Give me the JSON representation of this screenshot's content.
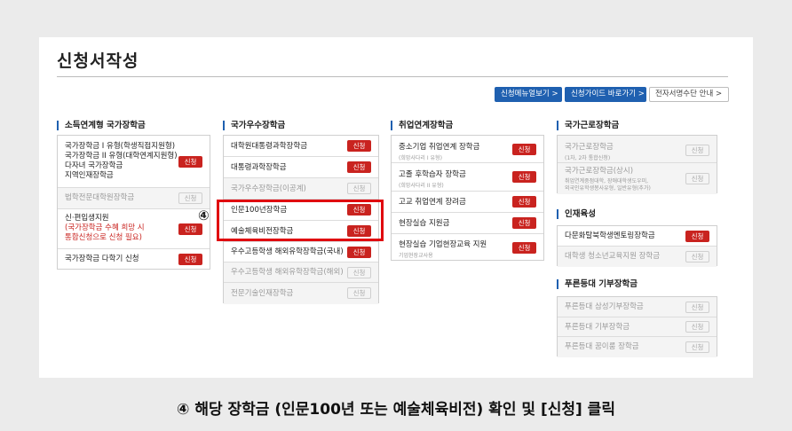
{
  "page": {
    "title": "신청서작성"
  },
  "top_links": [
    {
      "label": "신청메뉴얼보기 >"
    },
    {
      "label": "신청가이드 바로가기 >"
    },
    {
      "label": "전자서명수단 안내 >"
    }
  ],
  "columns": [
    {
      "title": "소득연계형 국가장학금",
      "items": [
        {
          "lines": [
            "국가장학금 I 유형(학생직접지원형)",
            "국가장학금 II 유형(대학연계지원형)",
            "다자녀 국가장학금",
            "지역인재장학금"
          ],
          "button": "신청",
          "enabled": true
        },
        {
          "lines": [
            "법학전문대학원장학금"
          ],
          "button": "신청",
          "enabled": false
        },
        {
          "lines": [
            "신·편입생지원",
            "(국가장학금 수혜 희망 시",
            "통합신청으로 신청 필요)"
          ],
          "button": "신청",
          "enabled": true
        },
        {
          "lines": [
            "국가장학금 다학기 신청"
          ],
          "button": "신청",
          "enabled": true
        }
      ]
    },
    {
      "title": "국가우수장학금",
      "items": [
        {
          "lines": [
            "대학원대통령과학장학금"
          ],
          "button": "신청",
          "enabled": true
        },
        {
          "lines": [
            "대통령과학장학금"
          ],
          "button": "신청",
          "enabled": true
        },
        {
          "lines": [
            "국가우수장학금(이공계)"
          ],
          "button": "신청",
          "enabled": false
        },
        {
          "lines": [
            "인문100년장학금"
          ],
          "button": "신청",
          "enabled": true
        },
        {
          "lines": [
            "예술체육비전장학금"
          ],
          "button": "신청",
          "enabled": true
        },
        {
          "lines": [
            "우수고등학생 해외유학장학금(국내)"
          ],
          "button": "신청",
          "enabled": true
        },
        {
          "lines": [
            "우수고등학생 해외유학장학금(해외)"
          ],
          "button": "신청",
          "enabled": false
        },
        {
          "lines": [
            "전문기술인재장학금"
          ],
          "button": "신청",
          "enabled": false
        }
      ]
    },
    {
      "title": "취업연계장학금",
      "items": [
        {
          "lines": [
            "중소기업 취업연계 장학금"
          ],
          "sub": "(희망사다리 I 유형)",
          "button": "신청",
          "enabled": true
        },
        {
          "lines": [
            "고졸 후학습자 장학금"
          ],
          "sub": "(희망사다리 II 유형)",
          "button": "신청",
          "enabled": true
        },
        {
          "lines": [
            "고교 취업연계 장려금"
          ],
          "button": "신청",
          "enabled": true
        },
        {
          "lines": [
            "현장실습 지원금"
          ],
          "button": "신청",
          "enabled": true
        },
        {
          "lines": [
            "현장실습 기업현장교육 지원"
          ],
          "sub": "기업현장교사용",
          "button": "신청",
          "enabled": true
        }
      ]
    },
    {
      "title": "국가근로장학금",
      "items": [
        {
          "lines": [
            "국가근로장학금"
          ],
          "sub": "(1차, 2차 통합신청)",
          "button": "신청",
          "enabled": false
        },
        {
          "lines": [
            "국가근로장학금(상시)"
          ],
          "sub": "취업연계중점대학, 장애대학생도우미,",
          "sub2": "외국인유학생봉사유형, 일반유형(추가)",
          "button": "신청",
          "enabled": false
        }
      ],
      "sections": [
        {
          "title": "인재육성",
          "items": [
            {
              "lines": [
                "다문화탈북학생멘토링장학금"
              ],
              "button": "신청",
              "enabled": true
            },
            {
              "lines": [
                "대학생 청소년교육지원 장학금"
              ],
              "button": "신청",
              "enabled": false
            }
          ]
        },
        {
          "title": "푸른등대 기부장학금",
          "items": [
            {
              "lines": [
                "푸른등대 삼성기부장학금"
              ],
              "button": "신청",
              "enabled": false
            },
            {
              "lines": [
                "푸른등대 기부장학금"
              ],
              "button": "신청",
              "enabled": false
            },
            {
              "lines": [
                "푸른등대 꿈이룸 장학금"
              ],
              "button": "신청",
              "enabled": false
            }
          ]
        }
      ]
    }
  ],
  "annotation": {
    "badge": "④"
  },
  "caption": "④ 해당 장학금 (인문100년 또는 예술체육비전) 확인 및 [신청] 클릭",
  "colors": {
    "accent_blue": "#1f60b0",
    "button_red": "#c9231f",
    "highlight_red": "#e0070f"
  }
}
